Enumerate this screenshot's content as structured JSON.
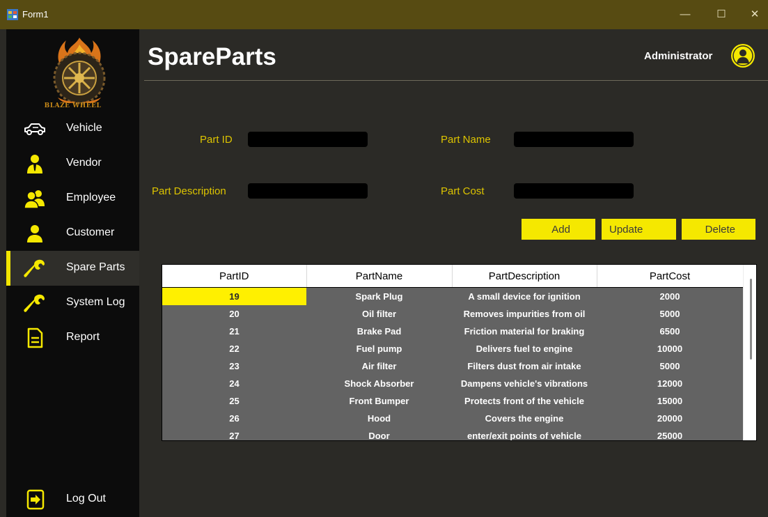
{
  "window": {
    "title": "Form1",
    "minimize": "—",
    "maximize": "☐",
    "close": "✕"
  },
  "sidebar": {
    "logo_text": "BLAZE WHEEL",
    "items": [
      {
        "label": "Vehicle",
        "icon": "car-icon",
        "active": false
      },
      {
        "label": "Vendor",
        "icon": "vendor-icon",
        "active": false
      },
      {
        "label": "Employee",
        "icon": "employees-icon",
        "active": false
      },
      {
        "label": "Customer",
        "icon": "customer-icon",
        "active": false
      },
      {
        "label": "Spare Parts",
        "icon": "wrench-icon",
        "active": true
      },
      {
        "label": "System Log",
        "icon": "wrench-icon",
        "active": false
      },
      {
        "label": "Report",
        "icon": "document-icon",
        "active": false
      }
    ],
    "logout": {
      "label": "Log Out",
      "icon": "logout-icon"
    }
  },
  "header": {
    "title": "SpareParts",
    "user": "Administrator",
    "user_icon": "user-avatar-icon"
  },
  "form": {
    "part_id_label": "Part ID",
    "part_id_value": "",
    "part_name_label": "Part Name",
    "part_name_value": "",
    "part_description_label": "Part Description",
    "part_description_value": "",
    "part_cost_label": "Part Cost",
    "part_cost_value": ""
  },
  "buttons": {
    "add": "Add",
    "update": "Update",
    "delete": "Delete"
  },
  "grid": {
    "columns": [
      "PartID",
      "PartName",
      "PartDescription",
      "PartCost"
    ],
    "rows": [
      [
        "19",
        "Spark Plug",
        "A small device for ignition",
        "2000"
      ],
      [
        "20",
        "Oil filter",
        "Removes impurities from oil",
        "5000"
      ],
      [
        "21",
        "Brake Pad",
        "Friction material for braking",
        "6500"
      ],
      [
        "22",
        "Fuel pump",
        "Delivers fuel to engine",
        "10000"
      ],
      [
        "23",
        "Air filter",
        "Filters dust from air intake",
        "5000"
      ],
      [
        "24",
        "Shock Absorber",
        "Dampens vehicle's vibrations",
        "12000"
      ],
      [
        "25",
        "Front Bumper",
        "Protects front of the vehicle",
        "15000"
      ],
      [
        "26",
        "Hood",
        "Covers the engine",
        "20000"
      ],
      [
        "27",
        "Door",
        "enter/exit points of vehicle",
        "25000"
      ]
    ]
  },
  "colors": {
    "accent": "#f5e800",
    "label": "#ddc400",
    "background": "#2b2a26",
    "sidebar": "#0c0c0c",
    "titlebar": "#574b12",
    "grid_row": "#636363"
  }
}
